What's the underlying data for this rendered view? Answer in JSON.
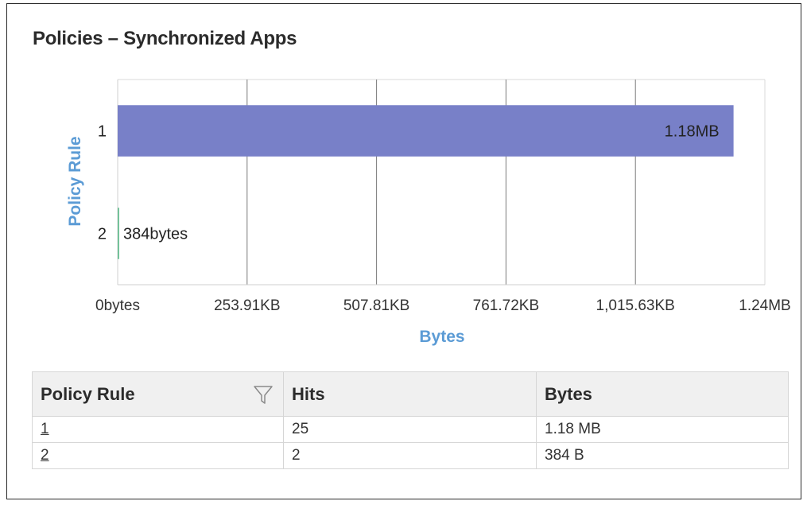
{
  "title": "Policies – Synchronized Apps",
  "colors": {
    "bar_primary": "#7880c8",
    "bar_secondary": "#74c29a",
    "axis_title": "#5b9bd5"
  },
  "chart_data": {
    "type": "bar",
    "orientation": "horizontal",
    "categories": [
      "1",
      "2"
    ],
    "values": [
      1237319,
      384
    ],
    "value_labels": [
      "1.18MB",
      "384bytes"
    ],
    "xlabel": "Bytes",
    "ylabel": "Policy Rule",
    "xlim": [
      0,
      1300234
    ],
    "xticks": [
      0,
      260047,
      520094,
      780140,
      1040187,
      1300234
    ],
    "xtick_labels": [
      "0bytes",
      "253.91KB",
      "507.81KB",
      "761.72KB",
      "1,015.63KB",
      "1.24MB"
    ],
    "grid": true
  },
  "table": {
    "columns": [
      "Policy Rule",
      "Hits",
      "Bytes"
    ],
    "rows": [
      {
        "rule": "1",
        "hits": "25",
        "bytes": "1.18 MB"
      },
      {
        "rule": "2",
        "hits": "2",
        "bytes": "384 B"
      }
    ]
  },
  "icons": {
    "filter": "filter-icon"
  }
}
